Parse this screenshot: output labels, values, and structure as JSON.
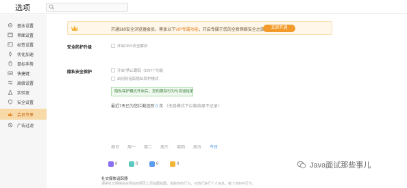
{
  "header": {
    "title": "选项",
    "search": {
      "placeholder": "",
      "value": ""
    }
  },
  "sidebar": {
    "items": [
      {
        "label": "基本设置",
        "icon": "gear-icon"
      },
      {
        "label": "界面设置",
        "icon": "layout-icon"
      },
      {
        "label": "标签设置",
        "icon": "tag-icon"
      },
      {
        "label": "优化加速",
        "icon": "rocket-icon"
      },
      {
        "label": "鼠标手势",
        "icon": "mouse-icon"
      },
      {
        "label": "快捷键",
        "icon": "keyboard-icon"
      },
      {
        "label": "高级设置",
        "icon": "sliders-icon"
      },
      {
        "label": "实验室",
        "icon": "flask-icon"
      },
      {
        "label": "安全设置",
        "icon": "shield-icon"
      },
      {
        "label": "会员专享",
        "icon": "vip-icon",
        "active": true
      },
      {
        "label": "广告过滤",
        "icon": "block-icon"
      }
    ]
  },
  "banner": {
    "text_before": "开通360安全浏览器会员，尊享以下",
    "text_highlight": "VIP专属功能",
    "text_after": "，开启专属于您的全新网络安全之旅~",
    "button_label": "立即开通"
  },
  "security_upgrade": {
    "title": "安全防护升级",
    "option": "开启DNS安全解析"
  },
  "privacy": {
    "title": "隐私安全保护",
    "options": [
      "开启“禁止跟踪（DNT）”功能",
      "启用防追踪隐私保护模式"
    ],
    "note": "隐私保护模式开启后，您的跟踪行为与发送给第三方的请求都将拦截，从而保护您的个人隐私"
  },
  "stats": {
    "prefix": "最近7天已为您拦截追踪",
    "count": "0",
    "unit": "次",
    "sub": "（无隐模式下拦截结果不记录）"
  },
  "days": [
    "周日",
    "周一",
    "周二",
    "周三",
    "周四",
    "周五",
    "今日"
  ],
  "metrics": [
    {
      "value": "0",
      "color": "#8a6df0"
    },
    {
      "value": "0",
      "color": "#5bc9c0"
    },
    {
      "value": "0",
      "color": "#5b9bf0"
    },
    {
      "value": "0",
      "color": "#f3b43a"
    }
  ],
  "card": {
    "title": "社交媒体追踪器",
    "desc": "通常社交网络会在网站的网页上添加跟踪器，追踪你的行为，对他们进行个人信息，被了你的可行为。"
  },
  "watermark": {
    "text": "Java面试那些事儿"
  }
}
